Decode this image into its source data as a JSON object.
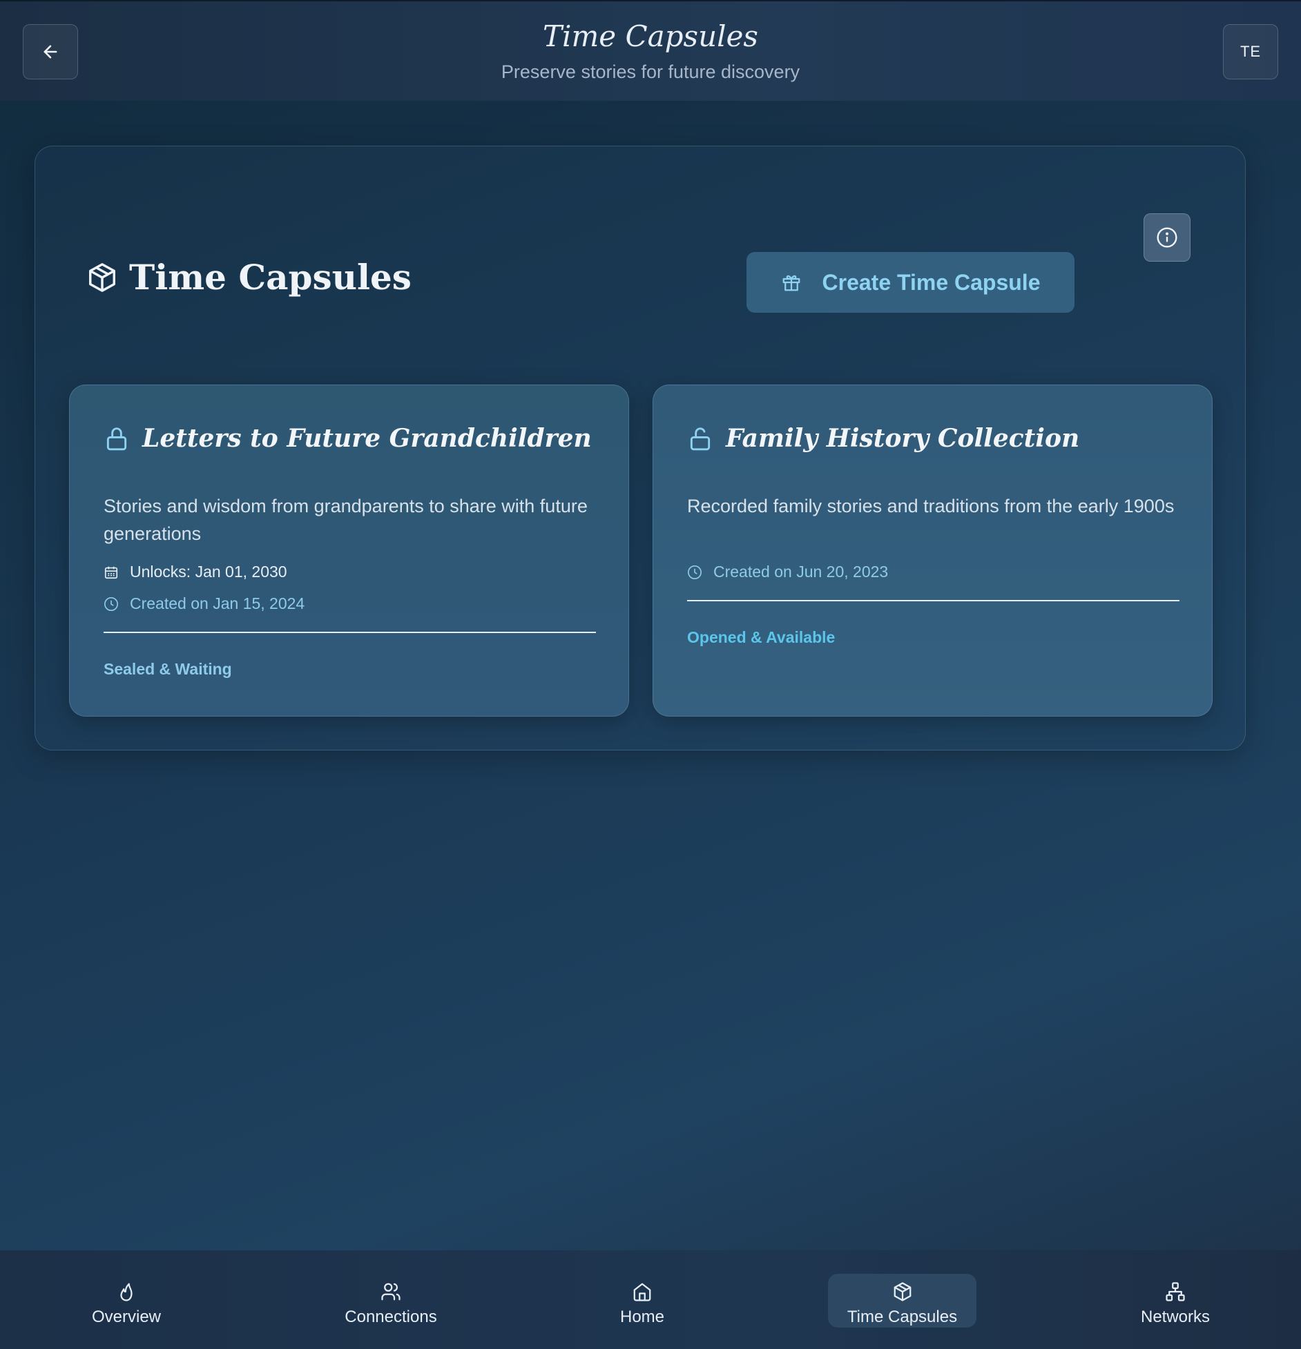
{
  "header": {
    "title": "Time Capsules",
    "subtitle": "Preserve stories for future discovery",
    "back_icon": "arrow-left-icon",
    "avatar_initials": "TE"
  },
  "panel": {
    "title": "Time Capsules",
    "title_icon": "package-icon",
    "create_button_label": "Create Time Capsule",
    "create_button_icon": "gift-icon",
    "info_icon": "info-icon"
  },
  "capsules": [
    {
      "title": "Letters to Future Grandchildren",
      "lock_icon": "lock-icon",
      "description": "Stories and wisdom from grandparents to share with future generations",
      "unlocks": "Unlocks: Jan 01, 2030",
      "created": "Created on Jan 15, 2024",
      "status": "Sealed & Waiting"
    },
    {
      "title": "Family History Collection",
      "lock_icon": "unlock-icon",
      "description": "Recorded family stories and traditions from the early 1900s",
      "created": "Created on Jun 20, 2023",
      "status": "Opened & Available"
    }
  ],
  "nav": {
    "items": [
      {
        "label": "Overview",
        "icon": "flame-icon"
      },
      {
        "label": "Connections",
        "icon": "users-icon"
      },
      {
        "label": "Home",
        "icon": "home-icon"
      },
      {
        "label": "Time Capsules",
        "icon": "package-icon",
        "active": true
      },
      {
        "label": "Networks",
        "icon": "network-icon"
      }
    ]
  },
  "colors": {
    "accent": "#8fd3f3",
    "status_open": "#5cc6ea",
    "background": "#1a3853"
  }
}
